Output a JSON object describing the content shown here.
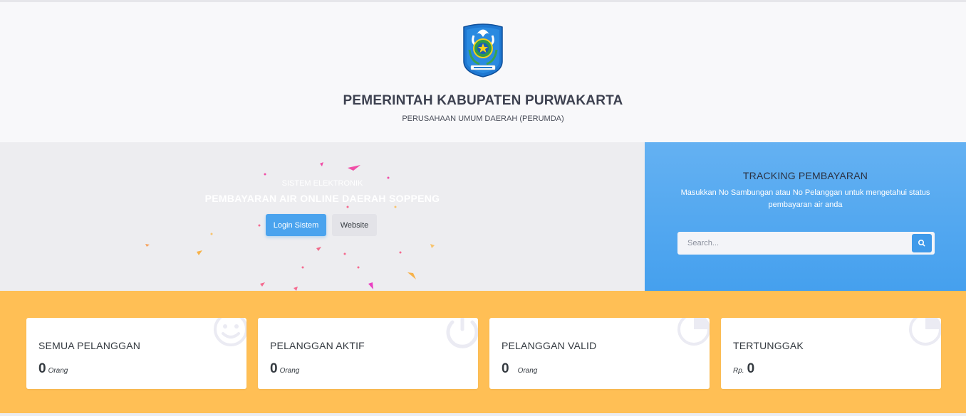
{
  "header": {
    "title": "PEMERINTAH KABUPATEN PURWAKARTA",
    "subtitle": "PERUSAHAAN UMUM DAERAH (PERUMDA)",
    "logo_icon": "regency-crest-icon"
  },
  "hero": {
    "small_title": "SISTEM ELEKTRONIK",
    "big_title": "PEMBAYARAN AIR ONLINE DAERAH SOPPENG",
    "login_label": "Login Sistem",
    "website_label": "Website"
  },
  "tracking": {
    "title": "TRACKING PEMBAYARAN",
    "description": "Masukkan No Sambungan atau No Pelanggan untuk mengetahui status pembayaran air anda",
    "search_placeholder": "Search...",
    "search_icon": "search-icon"
  },
  "stats": [
    {
      "label": "SEMUA PELANGGAN",
      "value": "0",
      "unit": "Orang",
      "icon": "smile-icon"
    },
    {
      "label": "PELANGGAN AKTIF",
      "value": "0",
      "unit": "Orang",
      "icon": "power-icon"
    },
    {
      "label": "PELANGGAN VALID",
      "value": "0",
      "unit": "Orang",
      "icon": "pie-chart-icon"
    },
    {
      "label": "TERTUNGGAK",
      "value": "0",
      "prefix": "Rp.",
      "icon": "pie-chart-icon"
    }
  ],
  "colors": {
    "accent_blue": "#4aa3ee",
    "stats_background": "#ffbf55",
    "hero_background": "#ededf0"
  }
}
